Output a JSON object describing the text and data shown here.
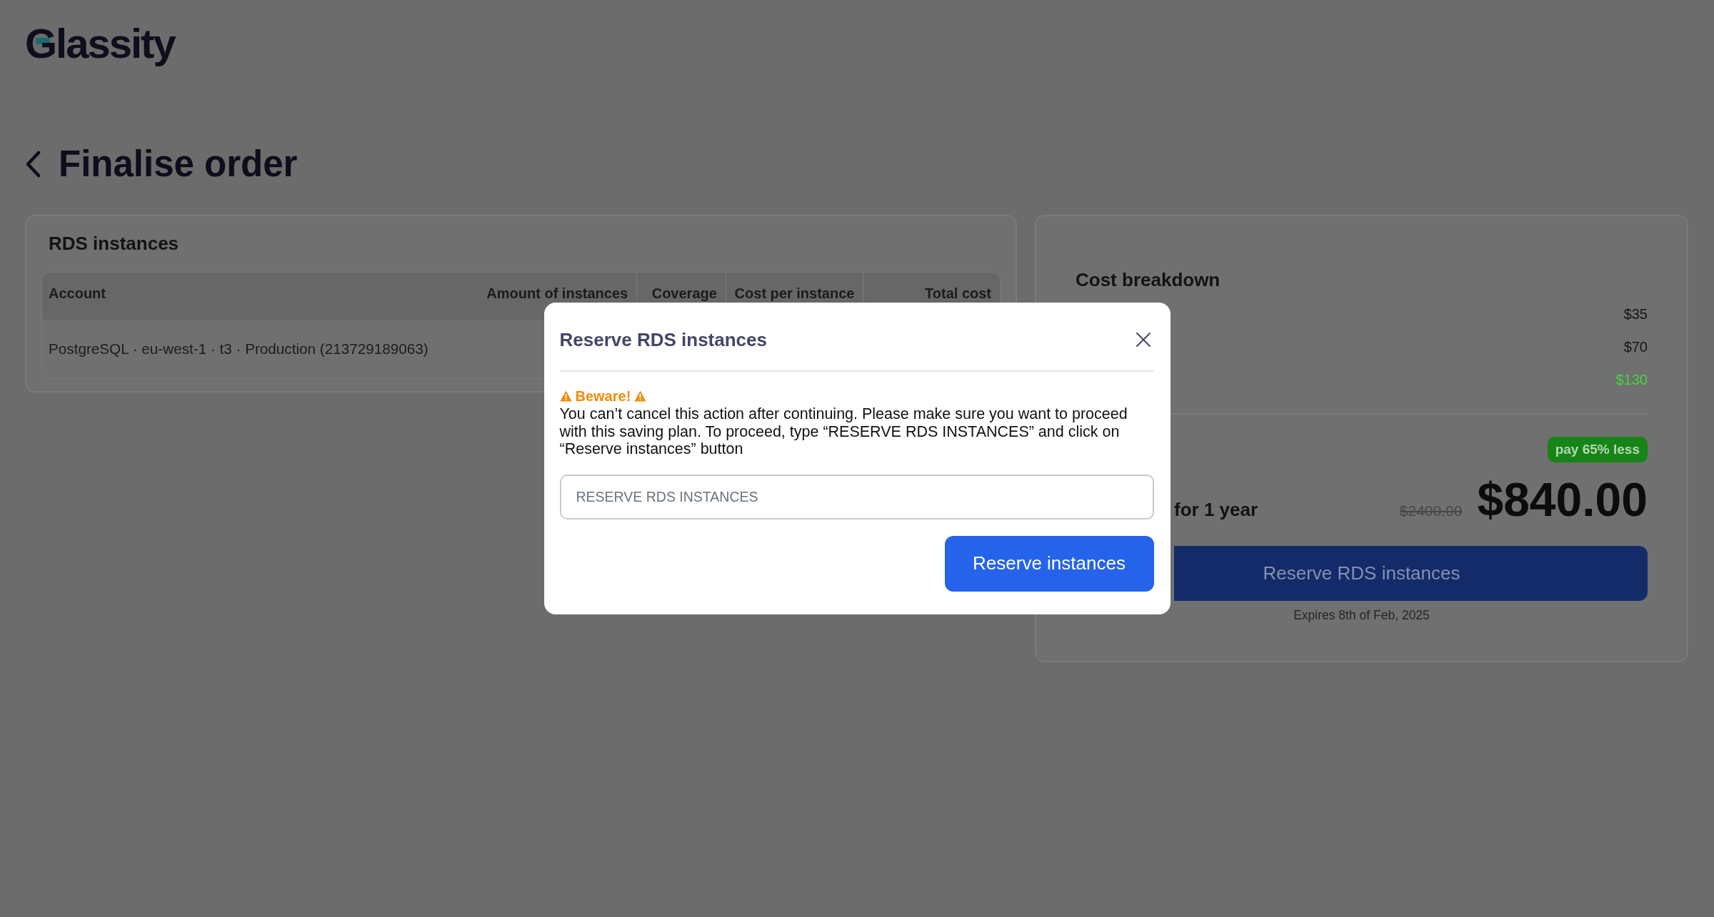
{
  "logo": {
    "text": "Glassity"
  },
  "page": {
    "title": "Finalise order"
  },
  "instances_card": {
    "title": "RDS instances",
    "table": {
      "columns": [
        "Account",
        "Amount of instances",
        "Coverage",
        "Cost per instance",
        "Total cost"
      ],
      "rows": [
        {
          "account": "PostgreSQL · eu-west-1 · t3 · Production (213729189063)"
        }
      ]
    }
  },
  "cost_card": {
    "title": "Cost breakdown",
    "lines": [
      {
        "kind": "charge",
        "value": "$35"
      },
      {
        "kind": "charge",
        "value": "$70"
      },
      {
        "kind": "saving",
        "value": "$130"
      }
    ],
    "badge": "pay 65% less",
    "total": {
      "label": "for 1 year",
      "original_price": "$2400.00",
      "price": "$840.00"
    },
    "button": "Reserve RDS instances",
    "expiry": "Expires 8th of Feb, 2025"
  },
  "modal": {
    "title": "Reserve RDS instances",
    "warning": {
      "title": "Beware!",
      "message": "You can’t cancel this action after continuing. Please make sure you want to proceed with this saving plan. To proceed, type “RESERVE RDS INSTANCES” and click on “Reserve instances” button"
    },
    "input": {
      "placeholder": "RESERVE RDS INSTANCES"
    },
    "confirm_button": "Reserve instances"
  }
}
